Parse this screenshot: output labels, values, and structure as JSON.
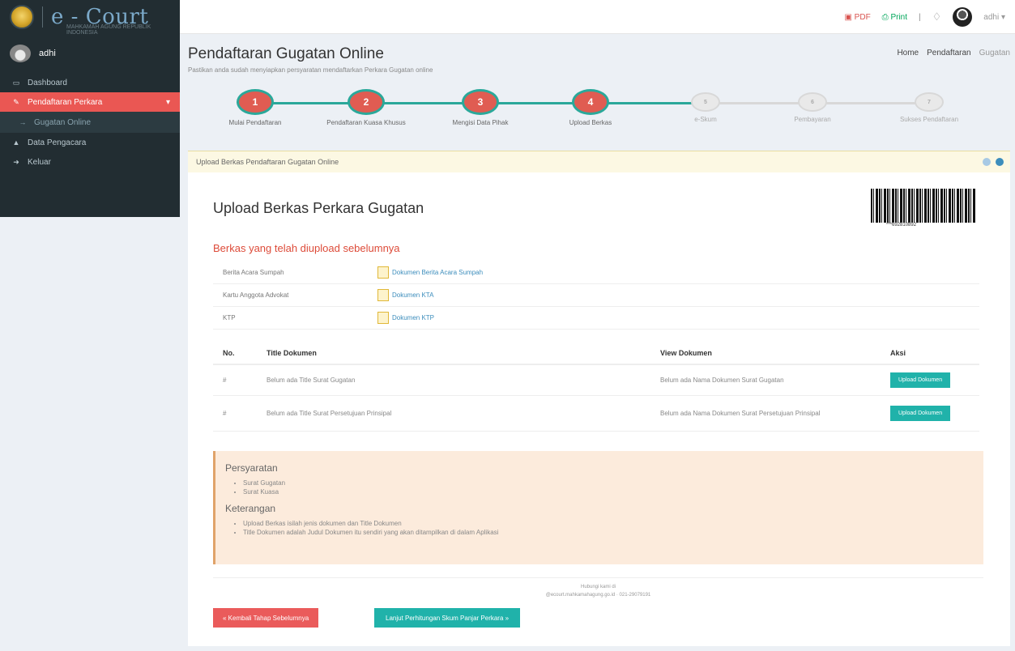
{
  "app": {
    "logo_text": "e - Court",
    "logo_sub": "MAHKAMAH AGUNG REPUBLIK INDONESIA"
  },
  "topbar": {
    "pdf_label": "PDF",
    "print_label": "Print",
    "separator": "|",
    "user_label": "adhi"
  },
  "sidebar": {
    "user_name": "adhi",
    "items": [
      {
        "label": "Dashboard"
      },
      {
        "label": "Pendaftaran Perkara"
      },
      {
        "label": "Gugatan Online"
      },
      {
        "label": "Data Pengacara"
      },
      {
        "label": "Keluar"
      }
    ]
  },
  "header": {
    "title": "Pendaftaran Gugatan Online",
    "description": "Pastikan anda sudah menyiapkan persyaratan mendaftarkan Perkara Gugatan online",
    "breadcrumb": [
      "Home",
      "Pendaftaran",
      "Gugatan"
    ]
  },
  "stepper": {
    "steps": [
      {
        "num": "1",
        "label": "Mulai Pendaftaran",
        "done": true
      },
      {
        "num": "2",
        "label": "Pendaftaran Kuasa Khusus",
        "done": true
      },
      {
        "num": "3",
        "label": "Mengisi Data Pihak",
        "done": true
      },
      {
        "num": "4",
        "label": "Upload Berkas",
        "done": true
      },
      {
        "num": "5",
        "label": "e-Skum",
        "done": false
      },
      {
        "num": "6",
        "label": "Pembayaran",
        "done": false
      },
      {
        "num": "7",
        "label": "Sukses Pendaftaran",
        "done": false
      }
    ]
  },
  "panel": {
    "header": "Upload Berkas Pendaftaran Gugatan Online",
    "title": "Upload Berkas Perkara Gugatan",
    "barcode_text": "***692810892",
    "uploaded_title": "Berkas yang telah diupload sebelumnya",
    "uploaded": [
      {
        "label": "Berita Acara Sumpah",
        "link": "Dokumen Berita Acara Sumpah"
      },
      {
        "label": "Kartu Anggota Advokat",
        "link": "Dokumen KTA"
      },
      {
        "label": "KTP",
        "link": "Dokumen KTP"
      }
    ],
    "table": {
      "headers": {
        "no": "No.",
        "title": "Title Dokumen",
        "view": "View Dokumen",
        "aksi": "Aksi"
      },
      "rows": [
        {
          "no": "#",
          "title": "Belum ada Title Surat Gugatan",
          "view": "Belum ada Nama Dokumen Surat Gugatan",
          "action": "Upload Dokumen"
        },
        {
          "no": "#",
          "title": "Belum ada Title Surat Persetujuan Prinsipal",
          "view": "Belum ada Nama Dokumen Surat Persetujuan Prinsipal",
          "action": "Upload Dokumen"
        }
      ]
    },
    "requirements": {
      "title": "Persyaratan",
      "items": [
        "Surat Gugatan",
        "Surat Kuasa"
      ],
      "notes_title": "Keterangan",
      "notes": [
        "Upload Berkas isilah jenis dokumen dan Title Dokumen",
        "Title Dokumen adalah Judul Dokumen itu sendiri yang akan ditampilkan di dalam Aplikasi"
      ]
    },
    "footer": {
      "line1": "Hubungi kami di",
      "line2": "@ecourt.mahkamahagung.go.id · 021-29079191"
    },
    "btn_back": "« Kembali Tahap Sebelumnya",
    "btn_next": "Lanjut Perhitungan Skum Panjar Perkara »"
  }
}
